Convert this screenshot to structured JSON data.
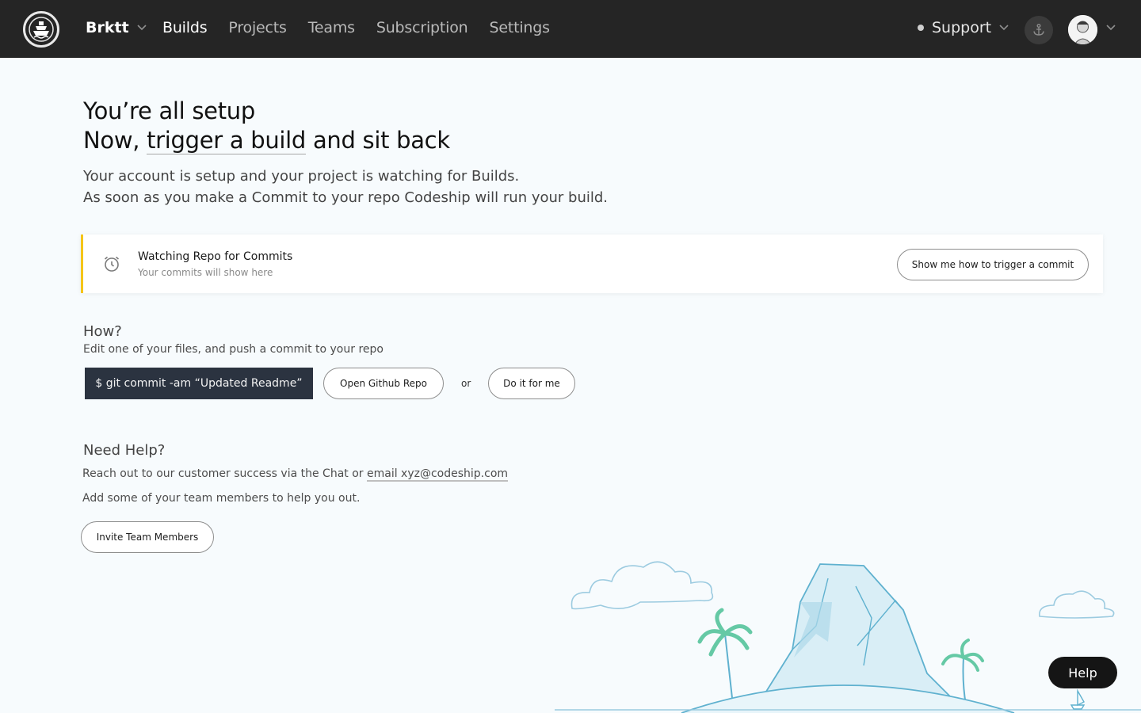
{
  "header": {
    "org_name": "Brktt",
    "nav": [
      "Builds",
      "Projects",
      "Teams",
      "Subscription",
      "Settings"
    ],
    "active_nav": "Builds",
    "support_label": "Support",
    "icons": {
      "logo": "ship-logo-icon",
      "dropdown": "chevron-down-icon",
      "anchor": "anchor-icon",
      "status": "status-dot-icon"
    }
  },
  "hero": {
    "line1": "You’re all setup",
    "line2_prefix": "Now, ",
    "line2_link": "trigger a build",
    "line2_suffix": " and sit back",
    "desc1": "Your account is setup and your project is watching for Builds.",
    "desc2": "As soon as you make a Commit to your repo Codeship will run your build."
  },
  "watch": {
    "title": "Watching Repo for Commits",
    "subtitle": "Your commits will show here",
    "button": "Show me how to trigger a commit",
    "accent": "#f5c518"
  },
  "how": {
    "title": "How?",
    "subtitle": "Edit one of your files, and push a commit to your repo",
    "command": "$ git commit -am “Updated Readme”",
    "open_repo": "Open Github Repo",
    "or": "or",
    "do_it": "Do it for me"
  },
  "help": {
    "title": "Need Help?",
    "line1_prefix": "Reach out to our customer success via the Chat or ",
    "email_link": "email xyz@codeship.com",
    "line2": "Add some of your team members to help you out.",
    "invite": "Invite Team Members",
    "fab": "Help"
  }
}
